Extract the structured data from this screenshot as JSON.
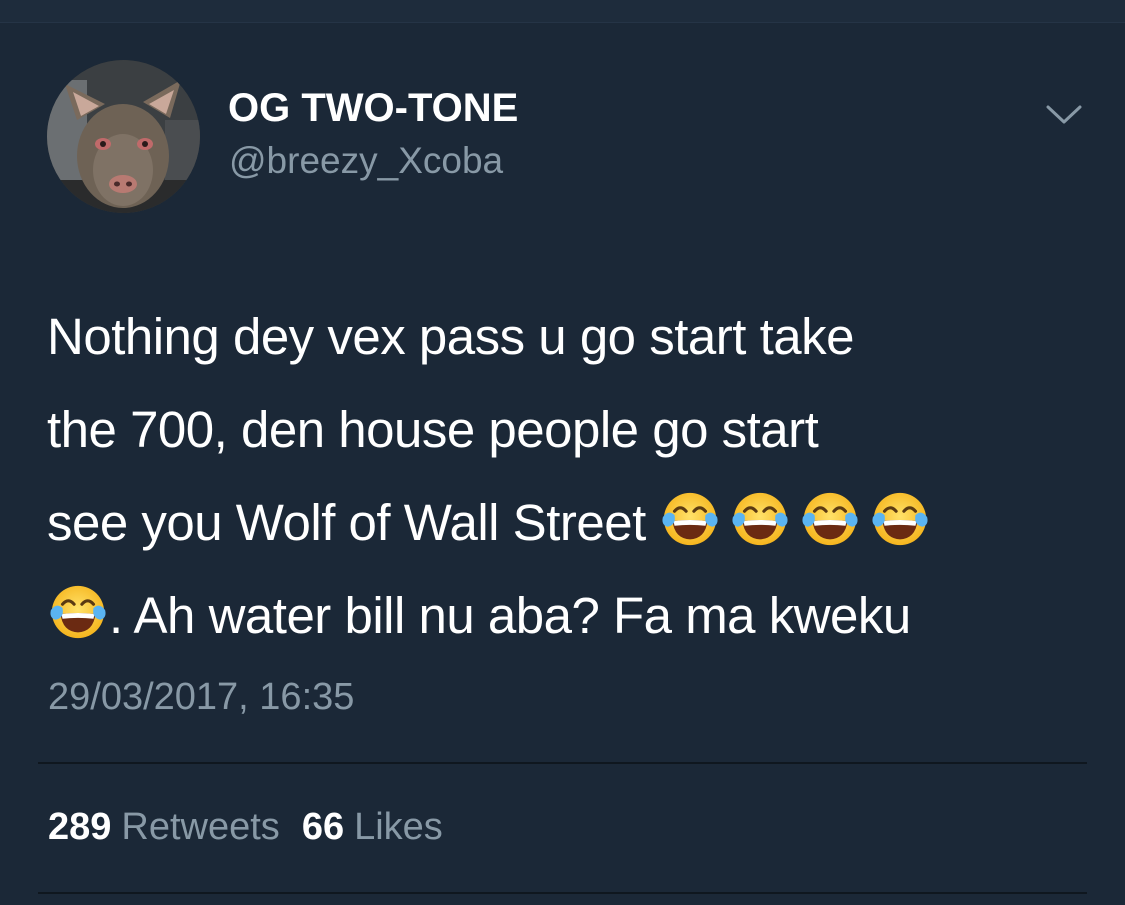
{
  "tweet": {
    "display_name": "OG TWO-TONE",
    "handle": "@breezy_Xcoba",
    "text_lines": [
      "Nothing dey vex pass u go start take",
      "the 700, den house people go start",
      "see you Wolf of Wall Street",
      ". Ah water bill nu aba? Fa ma kweku"
    ],
    "emoji_name": "face-with-tears-of-joy",
    "timestamp": "29/03/2017, 16:35",
    "retweets_count": "289",
    "retweets_label": "Retweets",
    "likes_count": "66",
    "likes_label": "Likes"
  },
  "icons": {
    "menu": "chevron-down-icon",
    "avatar": "dog-avatar"
  },
  "colors": {
    "background": "#1b2837",
    "primary_text": "#ffffff",
    "secondary_text": "#8899a6",
    "divider": "#0f171f"
  }
}
